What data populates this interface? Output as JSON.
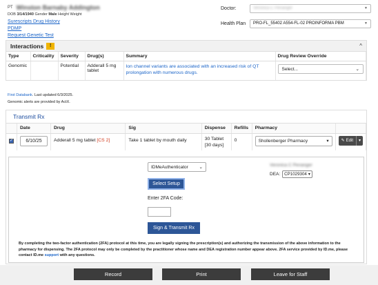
{
  "patient": {
    "prefix": "PT",
    "name": "Winston Barnaby Addington",
    "dob_label": "DOB",
    "dob": "3/14/1940",
    "gender_label": "Gender",
    "gender": "Male",
    "height_label": "Height",
    "weight_label": "Weight",
    "links": [
      "Surescripts Drug History",
      "PDMP",
      "Request Genetic Test"
    ]
  },
  "header": {
    "doctor_label": "Doctor:",
    "doctor_value": "Veronica C Penanger",
    "health_plan_label": "Health Plan",
    "health_plan_value": "PRO-FL_55402 A554-FL-02 PROINFORMA PBM"
  },
  "interactions": {
    "title": "Interactions",
    "warn_glyph": "!",
    "collapse_glyph": "^",
    "columns": [
      "Type",
      "Criticality",
      "Severity",
      "Drug(s)",
      "Summary",
      "Drug Review Override"
    ],
    "row": {
      "type": "Genomic",
      "criticality": "",
      "severity": "Potential",
      "drugs": "Adderall 5 mg tablet",
      "summary": "Ion channel variants are associated with an increased risk of QT prolongation with numerous drugs.",
      "override_placeholder": "Select..."
    }
  },
  "notes": {
    "databank_link": "First Databank",
    "databank_text": ". Last updated 6/3/2025.",
    "genomic_text": "Genomic alerts are provided by ActX."
  },
  "transmit": {
    "title": "Transmit Rx",
    "columns": [
      "",
      "Date",
      "Drug",
      "Sig",
      "Dispense",
      "Refills",
      "Pharmacy",
      ""
    ],
    "row": {
      "date": "6/10/25",
      "drug": "Adderall 5 mg tablet",
      "schedule": "[CS 2]",
      "sig": "Take 1 tablet by mouth daily",
      "dispense_line1": "30 Tablet",
      "dispense_line2": "[30 days]",
      "refills": "0",
      "pharmacy": "Shollenberger Pharmacy",
      "edit_label": "Edit"
    }
  },
  "twofa": {
    "authenticator": "IDMeAuthenticator",
    "select_setup_label": "Select Setup",
    "code_label": "Enter 2FA Code:",
    "sign_label": "Sign & Transmit Rx",
    "prescriber_name": "Veronica C Penanger",
    "dea_label": "DEA:",
    "dea_value": "CP1029304",
    "legal_part1": "By completing the two-factor authentication (2FA) protocol at this time, you are legally signing the prescription(s) and authorizing the transmission of the above information to the pharmacy for dispensing. The 2FA protocol may only be completed by the practitioner whose name and DEA registration number appear above. 2FA service provided by ID.me, please contact ID.me",
    "legal_link": "support",
    "legal_part2": "with any questions."
  },
  "footer": {
    "record_label": "Record",
    "print_label": "Print",
    "leave_label": "Leave for Staff"
  },
  "colors": {
    "primary_button": "#2d5697",
    "dark_button": "#3c3c3c",
    "link": "#1a64c8",
    "cs_badge": "#d23b1e",
    "warning": "#f0b400"
  }
}
